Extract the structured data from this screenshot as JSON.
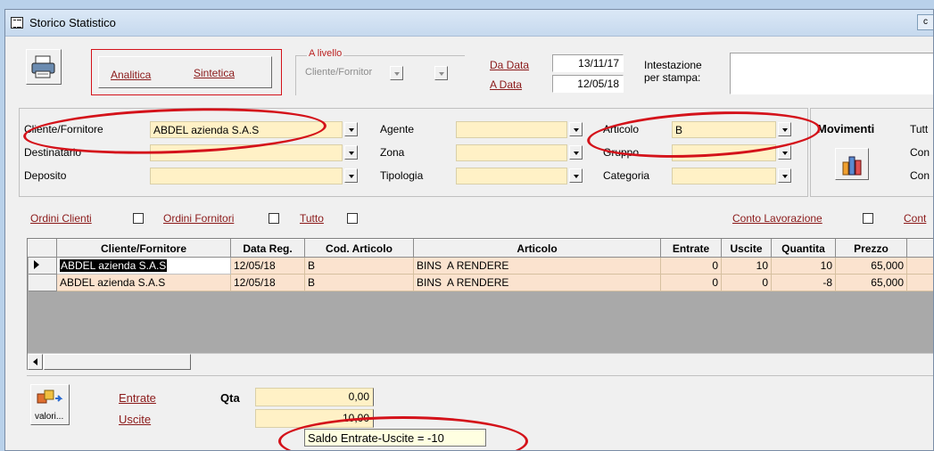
{
  "window": {
    "title": "Storico Statistico",
    "corner_label": "c"
  },
  "toolbar": {
    "analitica": "Analitica",
    "sintetica": "Sintetica",
    "a_livello_legend": "A livello",
    "livello_value": "Cliente/Fornitor",
    "da_data_label": "Da Data",
    "a_data_label": "A Data",
    "da_data_value": "13/11/17",
    "a_data_value": "12/05/18",
    "intestazione_label_1": "Intestazione",
    "intestazione_label_2": "per stampa:"
  },
  "filters": {
    "cliente_label": "Cliente/Fornitore",
    "cliente_value": "ABDEL azienda S.A.S",
    "destinatario_label": "Destinatario",
    "deposito_label": "Deposito",
    "agente_label": "Agente",
    "zona_label": "Zona",
    "tipologia_label": "Tipologia",
    "articolo_label": "Articolo",
    "articolo_value": "B",
    "gruppo_label": "Gruppo",
    "categoria_label": "Categoria",
    "movimenti_label": "Movimenti",
    "tutti_cut": "Tutt",
    "con1_cut": "Con",
    "con2_cut": "Con"
  },
  "options": {
    "ordini_clienti": "Ordini Clienti",
    "ordini_fornitori": "Ordini Fornitori",
    "tutto": "Tutto",
    "conto_lavorazione": "Conto Lavorazione",
    "cont_cut": "Cont"
  },
  "grid": {
    "headers": [
      "Cliente/Fornitore",
      "Data Reg.",
      "Cod. Articolo",
      "Articolo",
      "Entrate",
      "Uscite",
      "Quantita",
      "Prezzo"
    ],
    "rows": [
      [
        "ABDEL azienda S.A.S",
        "12/05/18",
        "B",
        "BINS  A RENDERE",
        "0",
        "10",
        "10",
        "65,000"
      ],
      [
        "ABDEL azienda S.A.S",
        "12/05/18",
        "B",
        "BINS  A RENDERE",
        "0",
        "0",
        "-8",
        "65,000"
      ]
    ]
  },
  "summary": {
    "valori_button": "valori...",
    "entrate_label": "Entrate",
    "uscite_label": "Uscite",
    "qta_label": "Qta",
    "entrate_value": "0,00",
    "uscite_value": "10,00",
    "tooltip": "Saldo Entrate-Uscite = -10"
  },
  "colors": {
    "accent_red": "#d4121a",
    "field_yellow": "#fff1c6",
    "row_peach": "#fbe3cf",
    "link_red": "#8b1a1a"
  }
}
